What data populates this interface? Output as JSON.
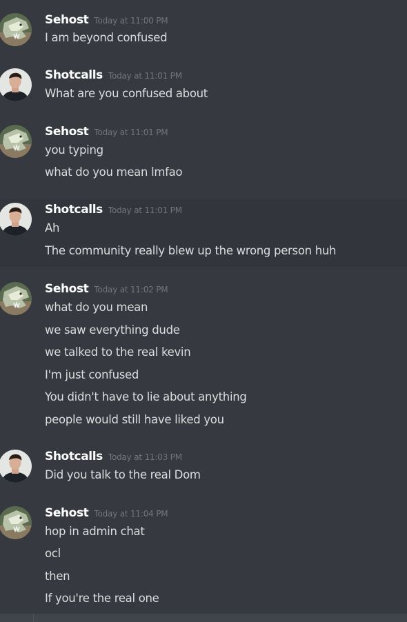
{
  "messages": [
    {
      "author": "Sehost",
      "avatar_icon": "dragon-avatar-icon",
      "timestamp": "Today at 11:00 PM",
      "lines": [
        "I am beyond confused"
      ]
    },
    {
      "author": "Shotcalls",
      "avatar_icon": "person-avatar-icon",
      "timestamp": "Today at 11:01 PM",
      "lines": [
        "What are you confused about"
      ]
    },
    {
      "author": "Sehost",
      "avatar_icon": "dragon-avatar-icon",
      "timestamp": "Today at 11:01 PM",
      "lines": [
        "you typing",
        "what do you mean lmfao"
      ]
    },
    {
      "author": "Shotcalls",
      "avatar_icon": "person-avatar-icon",
      "timestamp": "Today at 11:01 PM",
      "lines": [
        "Ah",
        "The community really blew up the wrong person huh"
      ]
    },
    {
      "author": "Sehost",
      "avatar_icon": "dragon-avatar-icon",
      "timestamp": "Today at 11:02 PM",
      "lines": [
        "what do you mean",
        "we saw everything dude",
        "we talked to the real kevin",
        "I'm just confused",
        "You didn't have to lie about anything",
        "people would still have liked you"
      ]
    },
    {
      "author": "Shotcalls",
      "avatar_icon": "person-avatar-icon",
      "timestamp": "Today at 11:03 PM",
      "lines": [
        "Did you talk to the real Dom"
      ]
    },
    {
      "author": "Sehost",
      "avatar_icon": "dragon-avatar-icon",
      "timestamp": "Today at 11:04 PM",
      "lines": [
        "hop in admin chat",
        "ocl",
        "then",
        "If you're the real one"
      ]
    }
  ],
  "colors": {
    "background": "#36393f",
    "username": "#ffffff",
    "timestamp": "#72767d",
    "message_text": "#dcddde",
    "input_bar": "#40444b"
  }
}
